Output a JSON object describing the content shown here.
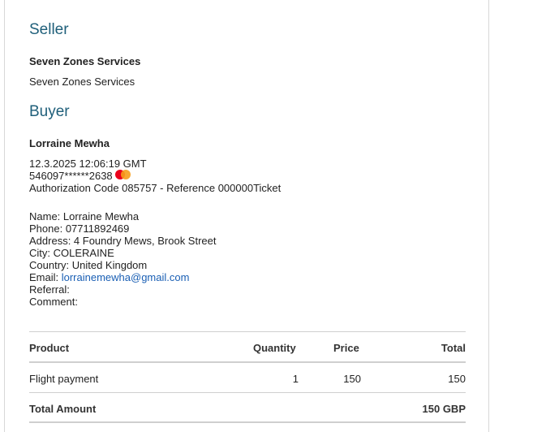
{
  "seller": {
    "heading": "Seller",
    "name_bold": "Seven Zones Services",
    "name": "Seven Zones Services"
  },
  "buyer": {
    "heading": "Buyer",
    "name_bold": "Lorraine Mewha",
    "datetime": "12.3.2025 12:06:19 GMT",
    "card_number": "546097******2638",
    "card_brand_icon": "mastercard-icon",
    "authorization": "Authorization Code 085757 - Reference 000000Ticket",
    "details": {
      "name": "Name: Lorraine Mewha",
      "phone": "Phone: 07711892469",
      "address": "Address: 4 Foundry Mews, Brook Street",
      "city": "City: COLERAINE",
      "country": "Country: United Kingdom",
      "email_label": "Email: ",
      "email": "lorrainemewha@gmail.com",
      "referral": "Referral:",
      "comment": "Comment:"
    }
  },
  "order_table": {
    "headers": {
      "product": "Product",
      "quantity": "Quantity",
      "price": "Price",
      "total": "Total"
    },
    "rows": [
      {
        "product": "Flight payment",
        "quantity": "1",
        "price": "150",
        "total": "150"
      }
    ],
    "total_label": "Total Amount",
    "total_value": "150 GBP"
  },
  "colors": {
    "heading": "#1f5f7a",
    "link": "#1a5fb4",
    "divider": "#cfcfcf"
  }
}
